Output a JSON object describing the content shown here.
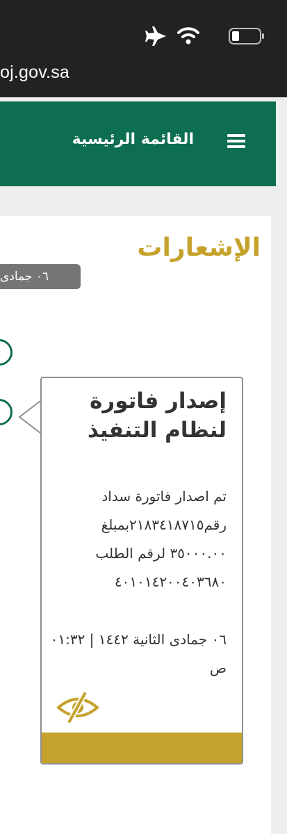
{
  "browser": {
    "url": "oj.gov.sa"
  },
  "header": {
    "menu_label": "القائمة الرئيسية"
  },
  "notifications": {
    "page_title": "الإشعارات",
    "date_group_label": "٠٦ جمادى",
    "card": {
      "title": "إصدار فاتورة لنظام التنفيذ",
      "body": "تم اصدار فاتورة سداد رقم٢١٨٣٤١٨٧١٥بمبلغ ٣٥٠٠٠.٠٠ لرقم الطلب ٤٠١٠١٤٢٠٠٤٠٣٦٨٠",
      "date": "٠٦ جمادى الثانية ١٤٤٢ | ٠١:٣٢ ص"
    }
  },
  "icons": {
    "airplane": "airplane-icon",
    "wifi": "wifi-icon",
    "battery": "battery-icon",
    "menu": "hamburger-menu-icon",
    "mark_read": "eye-slash-icon"
  },
  "colors": {
    "header_green": "#0d6e52",
    "accent_gold": "#c5a22c",
    "status_bar": "#222222",
    "pill_gray": "#757575"
  }
}
